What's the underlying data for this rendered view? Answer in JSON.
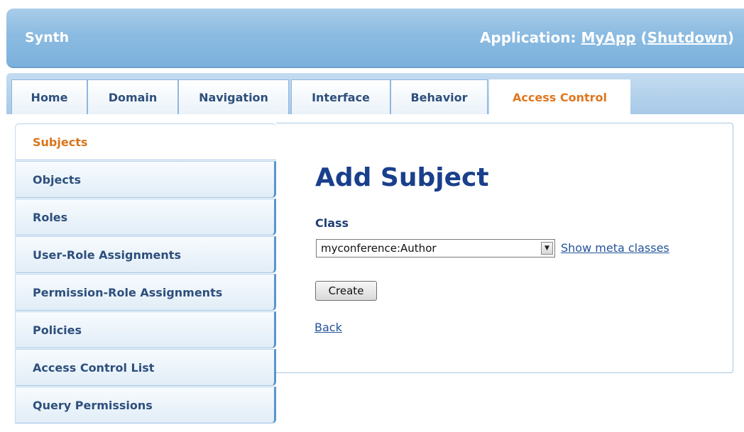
{
  "header": {
    "brand": "Synth",
    "app_prefix": "Application: ",
    "app_name": "MyApp",
    "open_paren": "(",
    "shutdown_label": "Shutdown",
    "close_paren": ")"
  },
  "tabs": [
    {
      "label": "Home"
    },
    {
      "label": "Domain"
    },
    {
      "label": "Navigation"
    },
    {
      "label": "Interface"
    },
    {
      "label": "Behavior"
    },
    {
      "label": "Access Control",
      "active": true
    }
  ],
  "sidebar": {
    "items": [
      {
        "label": "Subjects",
        "active": true
      },
      {
        "label": "Objects"
      },
      {
        "label": "Roles"
      },
      {
        "label": "User-Role Assignments"
      },
      {
        "label": "Permission-Role Assignments"
      },
      {
        "label": "Policies"
      },
      {
        "label": "Access Control List"
      },
      {
        "label": "Query Permissions"
      }
    ]
  },
  "main": {
    "title": "Add Subject",
    "class_label": "Class",
    "class_value": "myconference:Author",
    "show_meta_label": "Show meta classes",
    "create_label": "Create",
    "back_label": "Back"
  },
  "colors": {
    "accent_active": "#e0771f",
    "title_blue": "#1a3f8c",
    "header_blue": "#8bbbe1"
  }
}
